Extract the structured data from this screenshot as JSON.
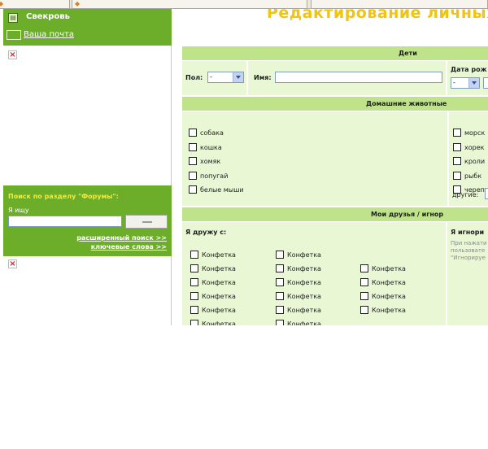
{
  "sidebar": {
    "user_name": "Свекровь",
    "mail_link": "Ваша почта",
    "forum_search": {
      "title": "Поиск по разделу \"Форумы\":",
      "label": "Я ищу",
      "input_value": "",
      "advanced_link": "расширенный поиск >>",
      "keywords_link": "ключевые слова >>"
    }
  },
  "main": {
    "page_title": "Редактирование личных",
    "children": {
      "header": "Дети",
      "gender_label": "Пол:",
      "gender_value": "-",
      "name_label": "Имя:",
      "name_value": "",
      "birth_label": "Дата рож",
      "birth_value": "-"
    },
    "pets": {
      "header": "Домашние животные",
      "left": [
        "собака",
        "кошка",
        "хомяк",
        "попугай",
        "белые мыши"
      ],
      "right": [
        "морск",
        "хорек",
        "кроли",
        "рыбк",
        "черепа"
      ],
      "other_label": "другие:"
    },
    "friends": {
      "header": "Мои друзья / игнор",
      "friends_label": "Я дружу с:",
      "friend_name": "Конфетка",
      "col1": [
        "Конфетка",
        "Конфетка",
        "Конфетка",
        "Конфетка",
        "Конфетка",
        "Конфетка"
      ],
      "col2": [
        "Конфетка",
        "Конфетка",
        "Конфетка",
        "Конфетка",
        "Конфетка",
        "Конфетка"
      ],
      "col3": [
        "Конфетка",
        "Конфетка",
        "Конфетка",
        "Конфетка"
      ],
      "ignore_label": "Я игнори",
      "ignore_note": [
        "При нажати",
        "пользовате",
        "\"Игнорируе"
      ]
    }
  },
  "colors": {
    "green_dark": "#6cae2a",
    "header_green": "#bfe38a",
    "body_green": "#e9f7d5",
    "title_yellow": "#f1c40f"
  }
}
